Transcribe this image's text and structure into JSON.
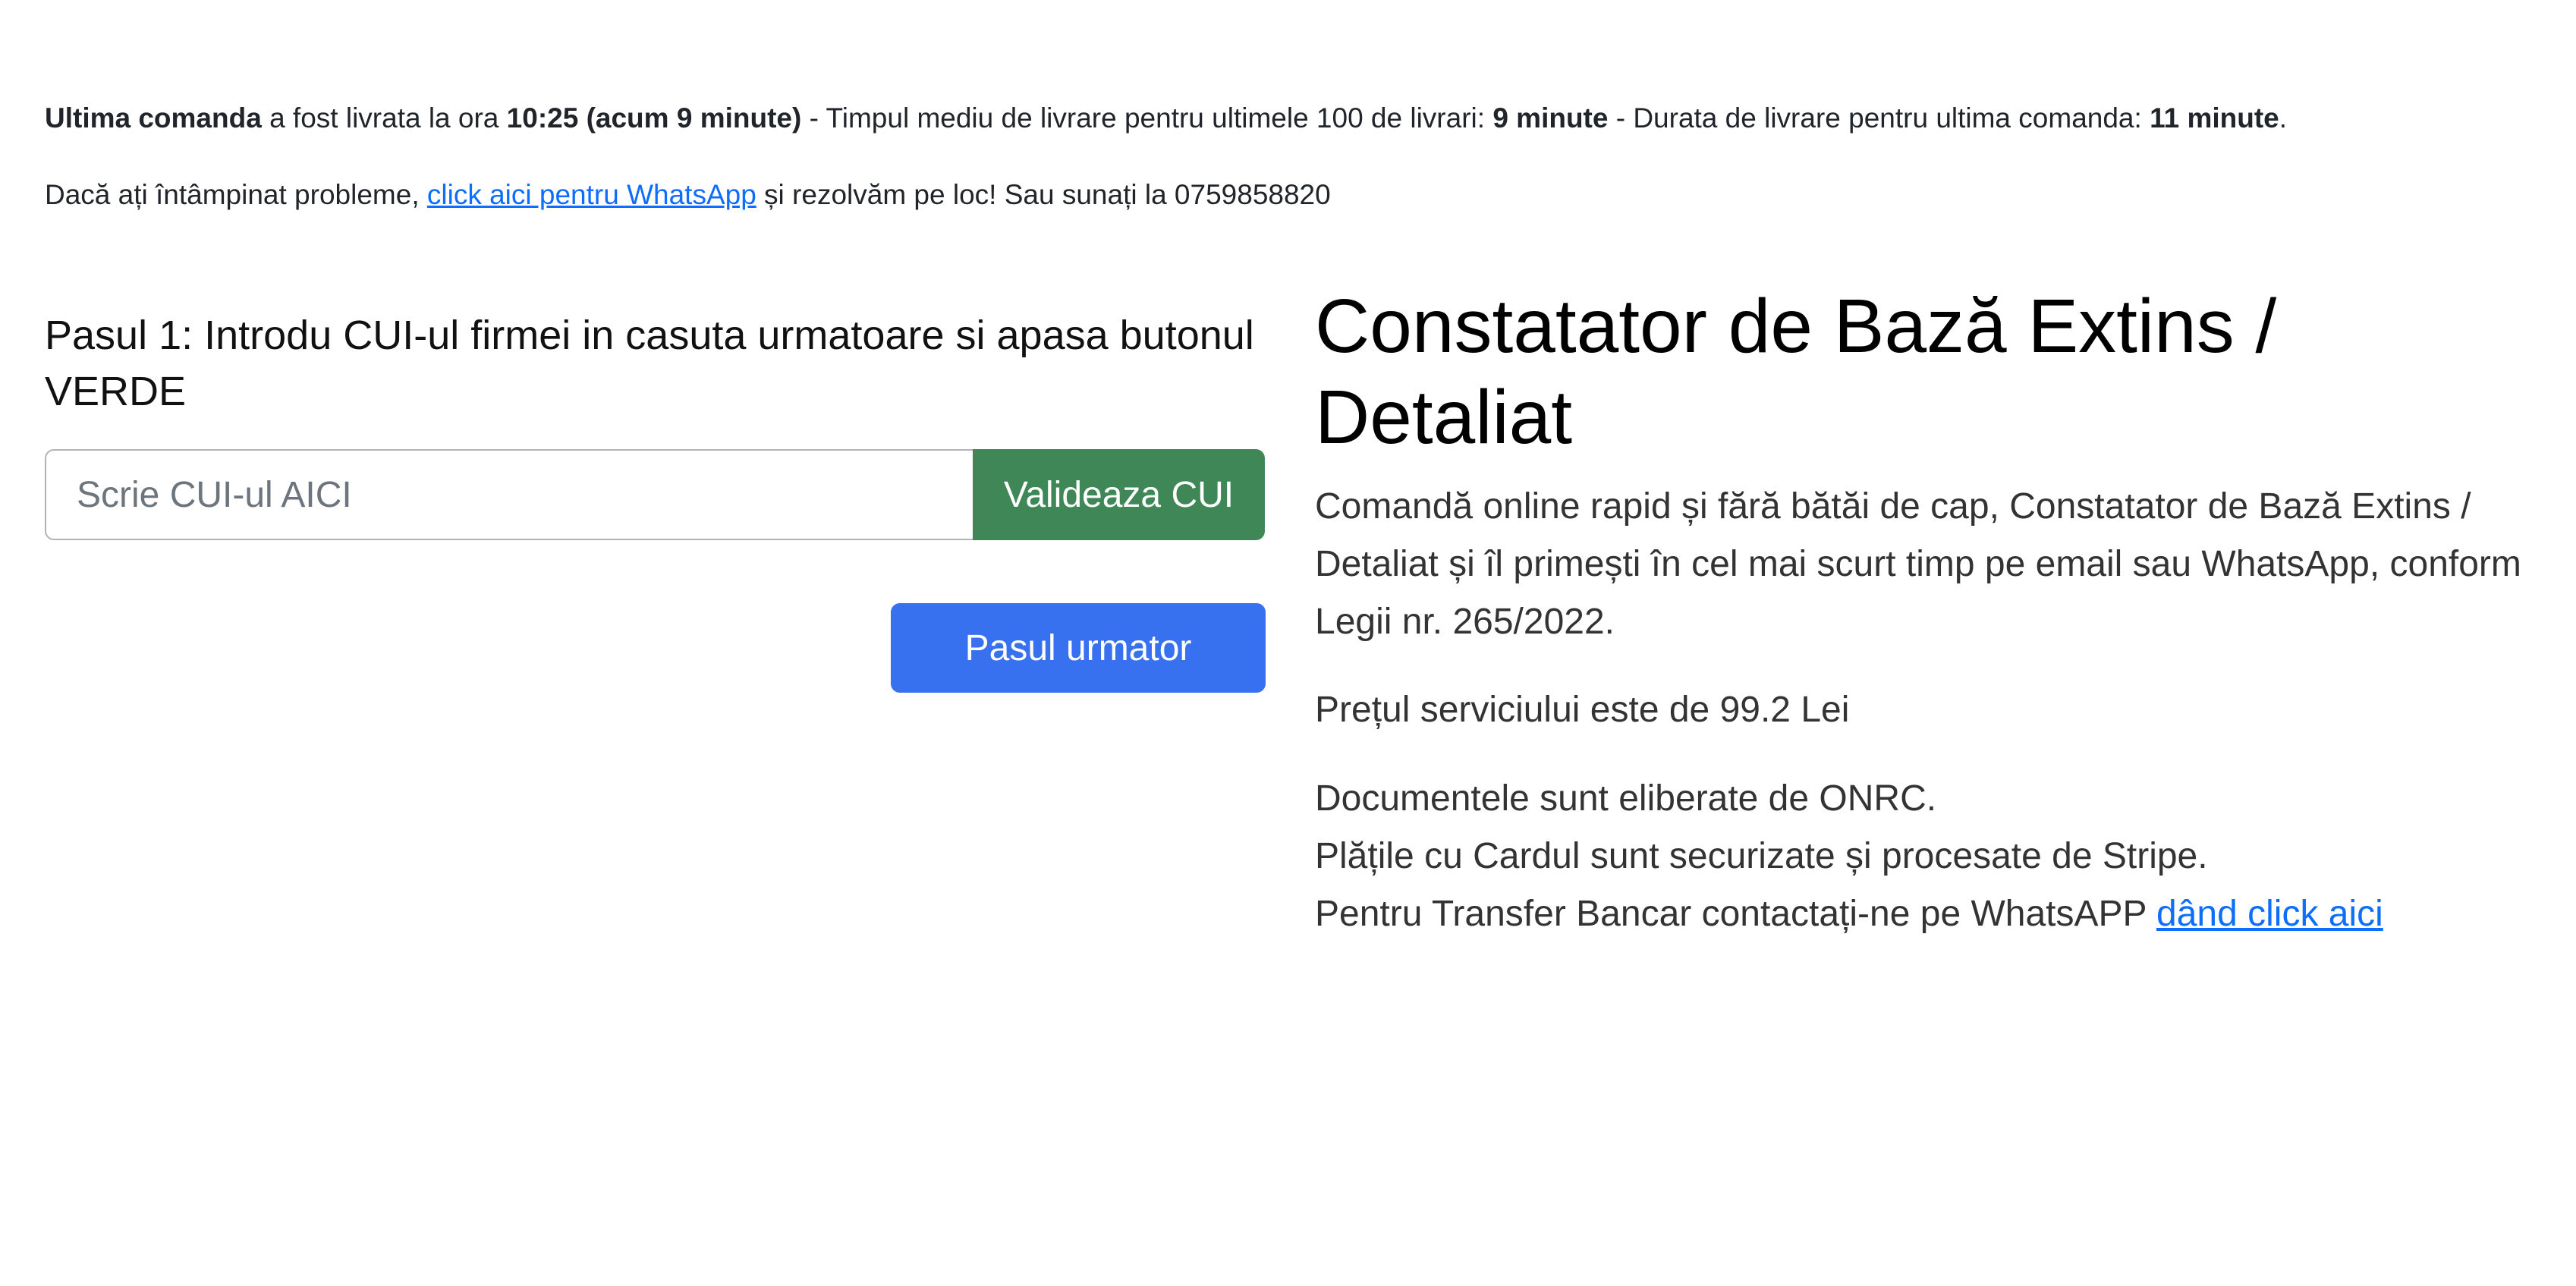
{
  "status": {
    "last_order_label": "Ultima comanda",
    "delivered_text": " a fost livrata la ora ",
    "delivered_time": "10:25 (acum 9 minute)",
    "avg_text": " - Timpul mediu de livrare pentru ultimele 100 de livrari: ",
    "avg_value": "9 minute",
    "duration_text": " - Durata de livrare pentru ultima comanda: ",
    "duration_value": "11 minute",
    "end": "."
  },
  "help": {
    "prefix": "Dacă ați întâmpinat probleme, ",
    "whatsapp_link": "click aici pentru WhatsApp",
    "suffix": " și rezolvăm pe loc! Sau sunați la 0759858820"
  },
  "step1": {
    "title": "Pasul 1: Introdu CUI-ul firmei in casuta urmatoare si apasa butonul VERDE",
    "input_placeholder": "Scrie CUI-ul AICI",
    "input_value": "",
    "validate_label": "Valideaza CUI",
    "next_label": "Pasul urmator"
  },
  "product": {
    "title": "Constatator de Bază Extins / Detaliat",
    "description": "Comandă online rapid și fără bătăi de cap, Constatator de Bază Extins / Detaliat și îl primești în cel mai scurt timp pe email sau WhatsApp, conform Legii nr. 265/2022.",
    "price": "Prețul serviciului este de 99.2 Lei",
    "issued_by": "Documentele sunt eliberate de ONRC.",
    "payments": "Plățile cu Cardul sunt securizate și procesate de Stripe.",
    "transfer_prefix": "Pentru Transfer Bancar contactați-ne pe WhatsAPP ",
    "transfer_link": "dând click aici"
  },
  "colors": {
    "validate_button": "#3f8756",
    "next_button": "#3871f0",
    "link": "#0d6efd"
  }
}
